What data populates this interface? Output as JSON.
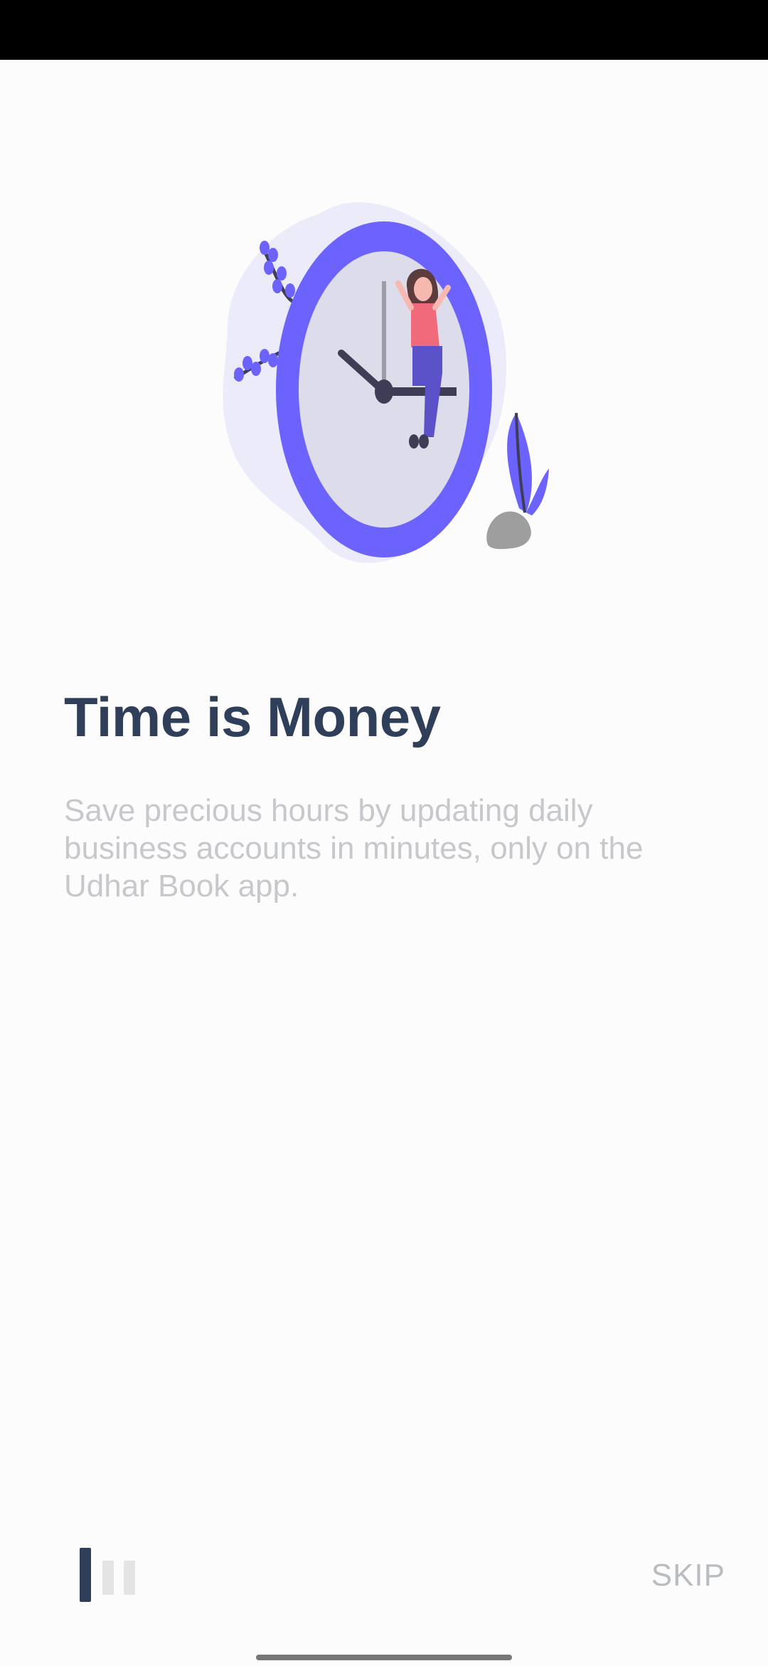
{
  "onboarding": {
    "title": "Time is Money",
    "description": "Save precious hours by updating daily business accounts in minutes, only on the Udhar Book app.",
    "skip_label": "SKIP",
    "page_indicator": {
      "total": 3,
      "current": 1
    }
  },
  "colors": {
    "title": "#2f3f5a",
    "description": "#c6c8cc",
    "accent_purple": "#6c63ff",
    "indicator_active": "#2f3f5a",
    "indicator_inactive": "#e4e4e4"
  },
  "illustration": {
    "name": "clock-with-woman-illustration"
  }
}
